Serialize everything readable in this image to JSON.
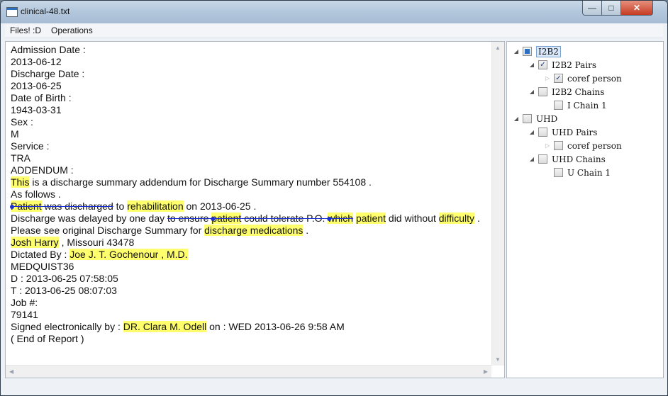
{
  "window": {
    "title": "clinical-48.txt"
  },
  "menu": {
    "files": "Files! :D",
    "operations": "Operations"
  },
  "document": {
    "lines": [
      [
        {
          "t": "Admission Date :"
        }
      ],
      [
        {
          "t": "2013-06-12"
        }
      ],
      [
        {
          "t": "Discharge Date :"
        }
      ],
      [
        {
          "t": "2013-06-25"
        }
      ],
      [
        {
          "t": "Date of Birth :"
        }
      ],
      [
        {
          "t": "1943-03-31"
        }
      ],
      [
        {
          "t": "Sex :"
        }
      ],
      [
        {
          "t": "M"
        }
      ],
      [
        {
          "t": "Service :"
        }
      ],
      [
        {
          "t": "TRA"
        }
      ],
      [
        {
          "t": "ADDENDUM :"
        }
      ],
      [
        {
          "t": "This",
          "hl": true
        },
        {
          "t": " is a discharge summary addendum for Discharge Summary number 554108 ."
        }
      ],
      [
        {
          "t": "As follows ."
        }
      ],
      [
        {
          "t": "Patient",
          "hl": true,
          "strike": true
        },
        {
          "t": " was discharged",
          "strike": true
        },
        {
          "t": " to "
        },
        {
          "t": "rehabilitation",
          "hl": true
        },
        {
          "t": " on 2013-06-25 ."
        }
      ],
      [
        {
          "t": "Discharge was delayed by one day "
        },
        {
          "t": "to ensure ",
          "strike": true
        },
        {
          "t": "patient",
          "hl": true,
          "strike": true
        },
        {
          "t": " could tolerate P.O. ",
          "strike": true
        },
        {
          "t": "which",
          "hl": true,
          "strike": true
        },
        {
          "t": " "
        },
        {
          "t": "patient",
          "hl": true
        },
        {
          "t": " did without "
        },
        {
          "t": "difficulty",
          "hl": true
        },
        {
          "t": " ."
        }
      ],
      [
        {
          "t": "Please see original Discharge Summary for "
        },
        {
          "t": "discharge medications",
          "hl": true
        },
        {
          "t": " ."
        }
      ],
      [
        {
          "t": "Josh Harry",
          "hl": true
        },
        {
          "t": " , Missouri 43478"
        }
      ],
      [
        {
          "t": "Dictated By : "
        },
        {
          "t": "Joe J. T. Gochenour , M.D.",
          "hl": true
        }
      ],
      [
        {
          "t": "MEDQUIST36"
        }
      ],
      [
        {
          "t": "D : 2013-06-25 07:58:05"
        }
      ],
      [
        {
          "t": "T : 2013-06-25 08:07:03"
        }
      ],
      [
        {
          "t": "Job #:"
        }
      ],
      [
        {
          "t": "79141"
        }
      ],
      [
        {
          "t": "Signed electronically by : "
        },
        {
          "t": "DR. Clara M. Odell",
          "hl": true
        },
        {
          "t": " on : WED 2013-06-26 9:58 AM"
        }
      ],
      [
        {
          "t": "( End of Report )"
        }
      ]
    ]
  },
  "tree": {
    "nodes": [
      {
        "label": "I2B2",
        "level": 0,
        "expander": "open",
        "check": "filled",
        "selected": true
      },
      {
        "label": "I2B2 Pairs",
        "level": 1,
        "expander": "open",
        "check": "checked"
      },
      {
        "label": "coref person",
        "level": 2,
        "expander": "closed",
        "check": "checked"
      },
      {
        "label": "I2B2 Chains",
        "level": 1,
        "expander": "open",
        "check": "none"
      },
      {
        "label": "I Chain 1",
        "level": 2,
        "expander": "none",
        "check": "none"
      },
      {
        "label": "UHD",
        "level": 0,
        "expander": "open",
        "check": "none"
      },
      {
        "label": "UHD Pairs",
        "level": 1,
        "expander": "open",
        "check": "none"
      },
      {
        "label": "coref person",
        "level": 2,
        "expander": "closed",
        "check": "none"
      },
      {
        "label": "UHD Chains",
        "level": 1,
        "expander": "open",
        "check": "none"
      },
      {
        "label": "U Chain 1",
        "level": 2,
        "expander": "none",
        "check": "none"
      }
    ]
  },
  "colors": {
    "highlight": "#ffff6e",
    "chain_line": "#1c2fcf",
    "selection": "#2f6fbf"
  },
  "icons": [
    "app-icon",
    "minimize-icon",
    "maximize-icon",
    "close-icon",
    "tree-expander-icon",
    "checkbox-icon",
    "scroll-arrow-icon"
  ]
}
